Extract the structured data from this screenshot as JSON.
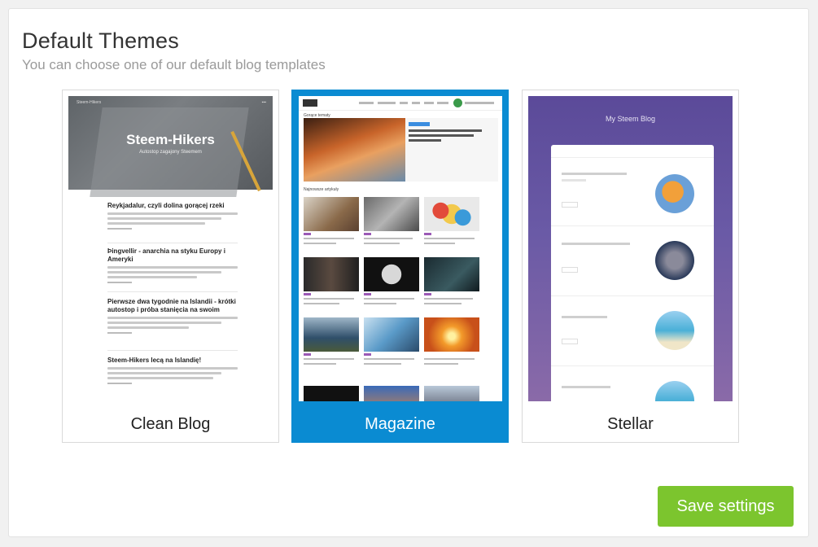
{
  "section": {
    "title": "Default Themes",
    "subtitle": "You can choose one of our default blog templates"
  },
  "themes": [
    {
      "label": "Clean Blog",
      "selected": false,
      "preview": {
        "nav_left": "Steem-Hikers",
        "hero_title": "Steem-Hikers",
        "hero_subtitle": "Autostop zagajony Steemem",
        "posts": [
          {
            "title": "Reykjadalur, czyli dolina gorącej rzeki"
          },
          {
            "title": "Þingvellir - anarchia na styku Europy i Ameryki"
          },
          {
            "title": "Pierwsze dwa tygodnie na Islandii - krótki autostop i próba stanięcia na swoim"
          },
          {
            "title": "Steem-Hikers lecą na Islandię!"
          }
        ]
      }
    },
    {
      "label": "Magazine",
      "selected": true,
      "preview": {
        "hot_header": "Gorące tematy",
        "latest_header": "Najnowsze artykuły"
      }
    },
    {
      "label": "Stellar",
      "selected": false,
      "preview": {
        "blog_title": "My Steem Blog"
      }
    }
  ],
  "actions": {
    "save_label": "Save settings"
  },
  "colors": {
    "selected_accent": "#0a8bd2",
    "save_button": "#7cc52e"
  }
}
